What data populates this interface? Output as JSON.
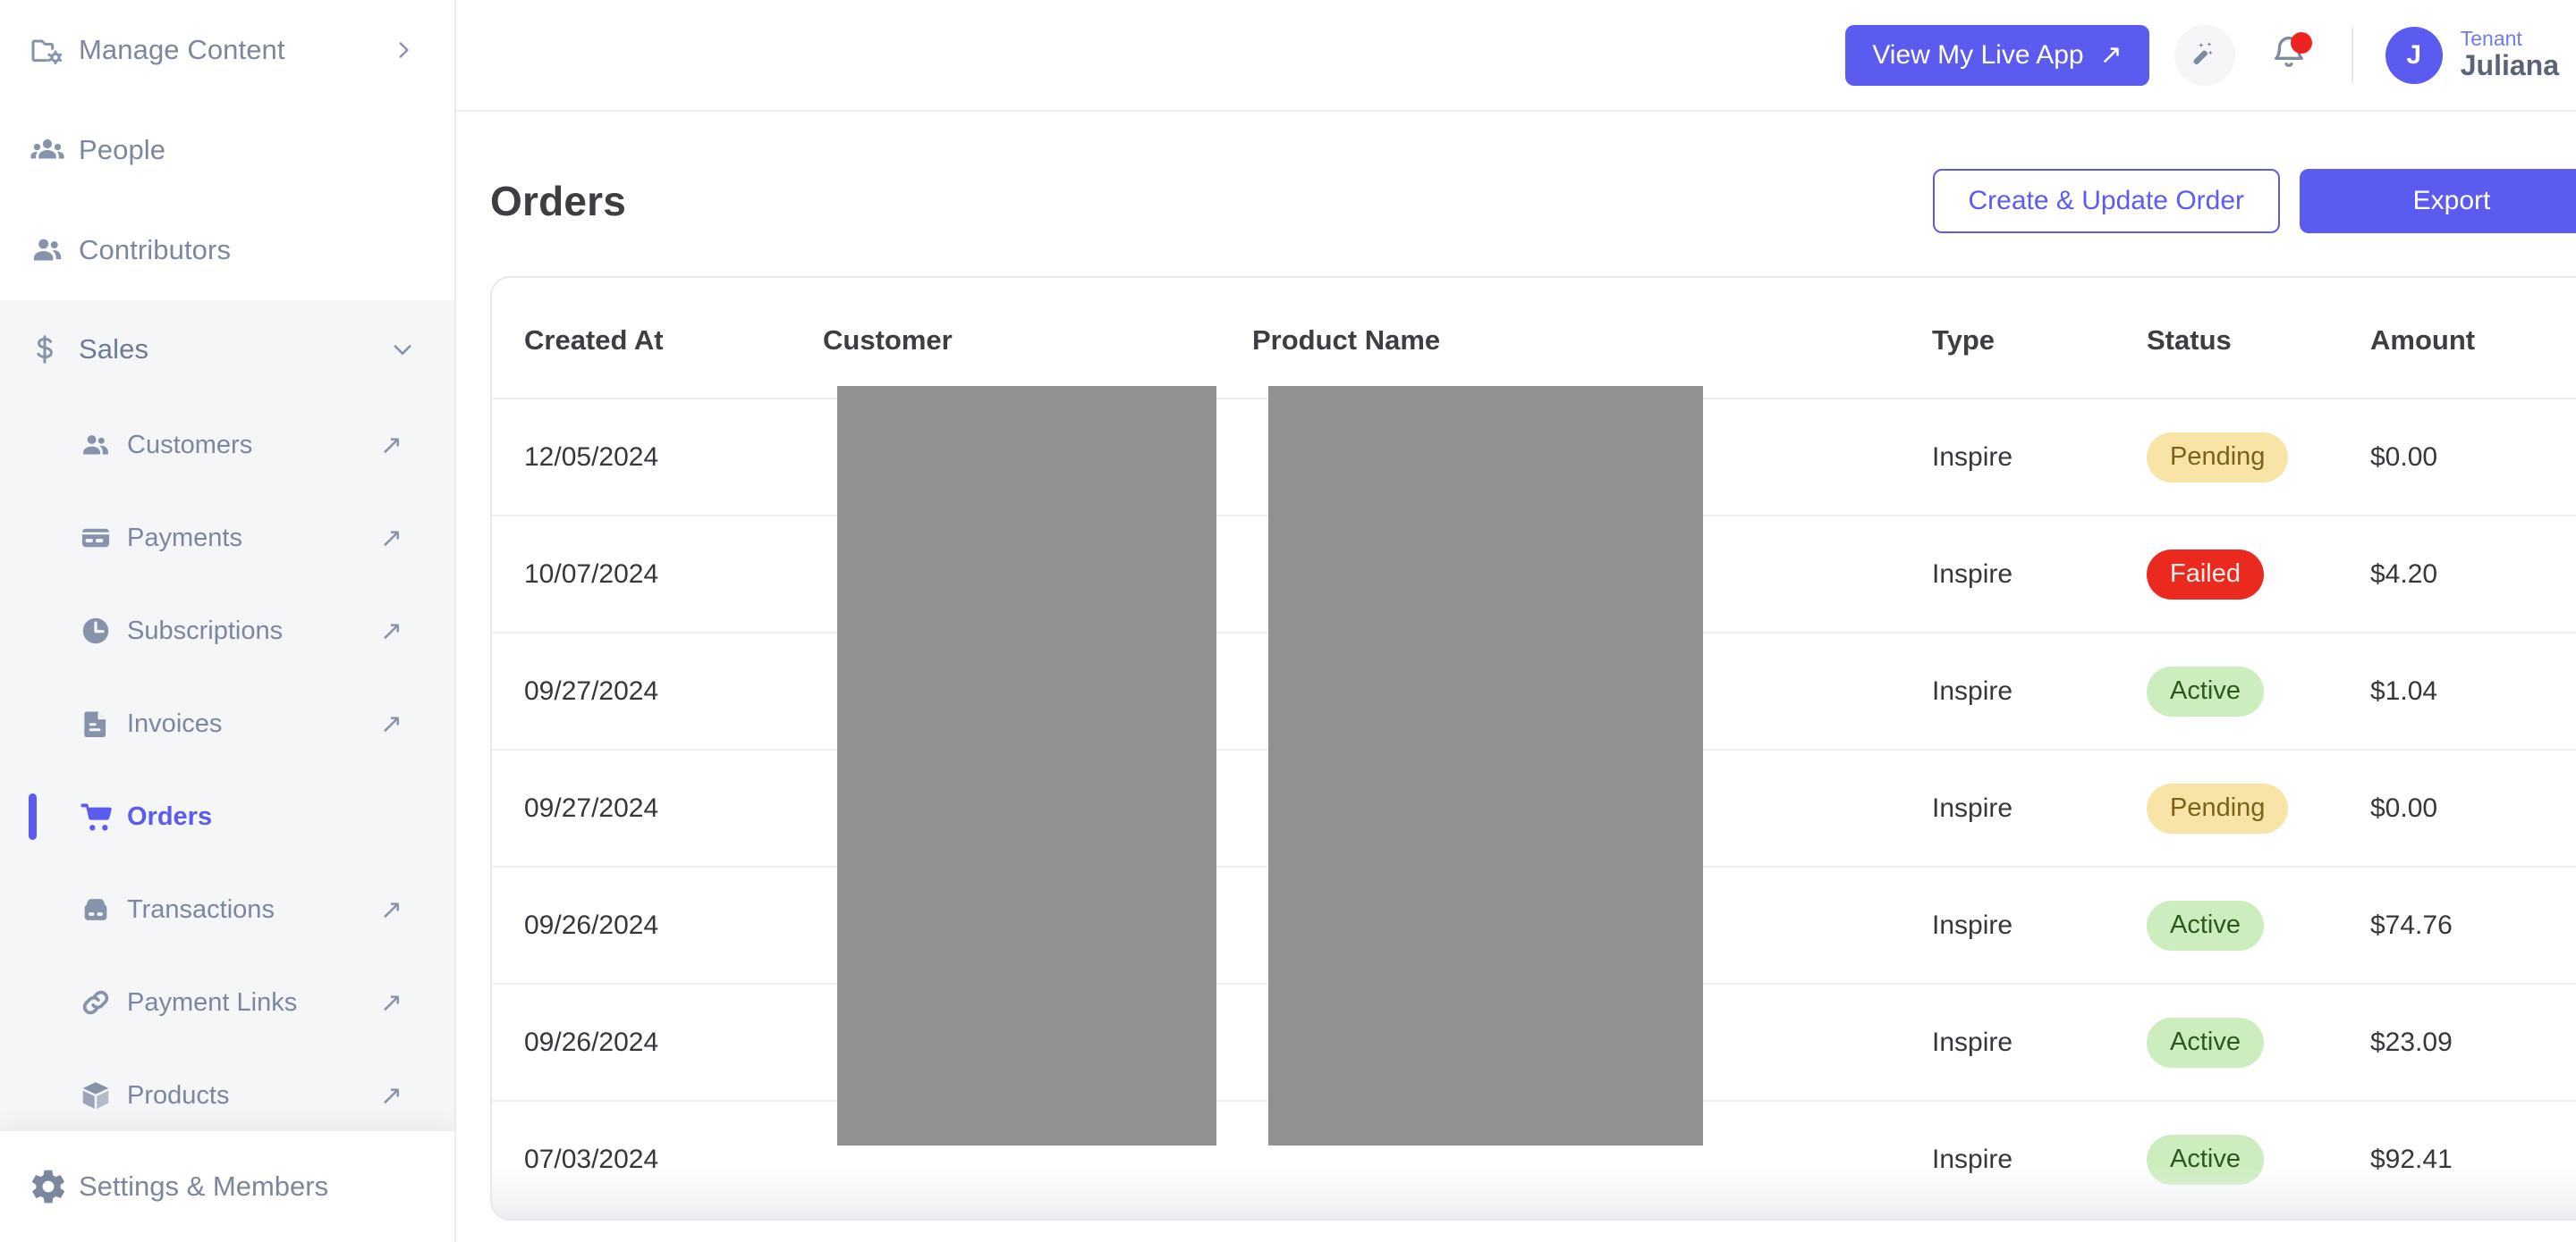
{
  "sidebar": {
    "top_items": [
      {
        "label": "Manage Content",
        "icon": "folder-settings-icon",
        "tail": "chevron-right-icon"
      },
      {
        "label": "People",
        "icon": "people-group-icon",
        "tail": ""
      },
      {
        "label": "Contributors",
        "icon": "contributors-icon",
        "tail": ""
      }
    ],
    "sales_group": {
      "label": "Sales",
      "icon": "dollar-icon",
      "tail": "chevron-down-icon",
      "items": [
        {
          "label": "Customers",
          "icon": "customers-icon",
          "external": "↗",
          "active": false
        },
        {
          "label": "Payments",
          "icon": "credit-card-icon",
          "external": "↗",
          "active": false
        },
        {
          "label": "Subscriptions",
          "icon": "clock-icon",
          "external": "↗",
          "active": false
        },
        {
          "label": "Invoices",
          "icon": "document-icon",
          "external": "↗",
          "active": false
        },
        {
          "label": "Orders",
          "icon": "shopping-cart-icon",
          "external": "",
          "active": true
        },
        {
          "label": "Transactions",
          "icon": "briefcase-icon",
          "external": "↗",
          "active": false
        },
        {
          "label": "Payment Links",
          "icon": "link-icon",
          "external": "↗",
          "active": false
        },
        {
          "label": "Products",
          "icon": "box-icon",
          "external": "↗",
          "active": false
        }
      ]
    },
    "footer": {
      "label": "Settings & Members",
      "icon": "gear-icon"
    }
  },
  "topbar": {
    "live_app_label": "View My Live App",
    "live_app_arrow": "↗",
    "magic_icon": "magic-wand-icon",
    "bell_icon": "notification-bell-icon",
    "has_notification": true,
    "user": {
      "avatar_initial": "J",
      "tenant_label": "Tenant",
      "name": "Juliana",
      "chevron": "chevron-down-icon"
    }
  },
  "page": {
    "title": "Orders",
    "create_button": "Create & Update Order",
    "export_button": "Export"
  },
  "table": {
    "columns": [
      "Created At",
      "Customer",
      "Product Name",
      "Type",
      "Status",
      "Amount"
    ],
    "rows": [
      {
        "created_at": "12/05/2024",
        "customer": "",
        "product_name": "",
        "type": "Inspire",
        "status": "Pending",
        "status_kind": "pending",
        "amount": "$0.00"
      },
      {
        "created_at": "10/07/2024",
        "customer": "",
        "product_name": "",
        "type": "Inspire",
        "status": "Failed",
        "status_kind": "failed",
        "amount": "$4.20"
      },
      {
        "created_at": "09/27/2024",
        "customer": "",
        "product_name": "",
        "type": "Inspire",
        "status": "Active",
        "status_kind": "active",
        "amount": "$1.04"
      },
      {
        "created_at": "09/27/2024",
        "customer": "",
        "product_name": "",
        "type": "Inspire",
        "status": "Pending",
        "status_kind": "pending",
        "amount": "$0.00"
      },
      {
        "created_at": "09/26/2024",
        "customer": "",
        "product_name": "",
        "type": "Inspire",
        "status": "Active",
        "status_kind": "active",
        "amount": "$74.76"
      },
      {
        "created_at": "09/26/2024",
        "customer": "",
        "product_name": "",
        "type": "Inspire",
        "status": "Active",
        "status_kind": "active",
        "amount": "$23.09"
      },
      {
        "created_at": "07/03/2024",
        "customer": "",
        "product_name": "",
        "type": "Inspire",
        "status": "Active",
        "status_kind": "active",
        "amount": "$92.41"
      }
    ]
  },
  "colors": {
    "accent": "#5b5bf0",
    "sidebar_text": "#7c879e",
    "status_pending_bg": "#f9e4a8",
    "status_failed_bg": "#ea2a1e",
    "status_active_bg": "#cdedbe",
    "redaction": "#919191"
  }
}
